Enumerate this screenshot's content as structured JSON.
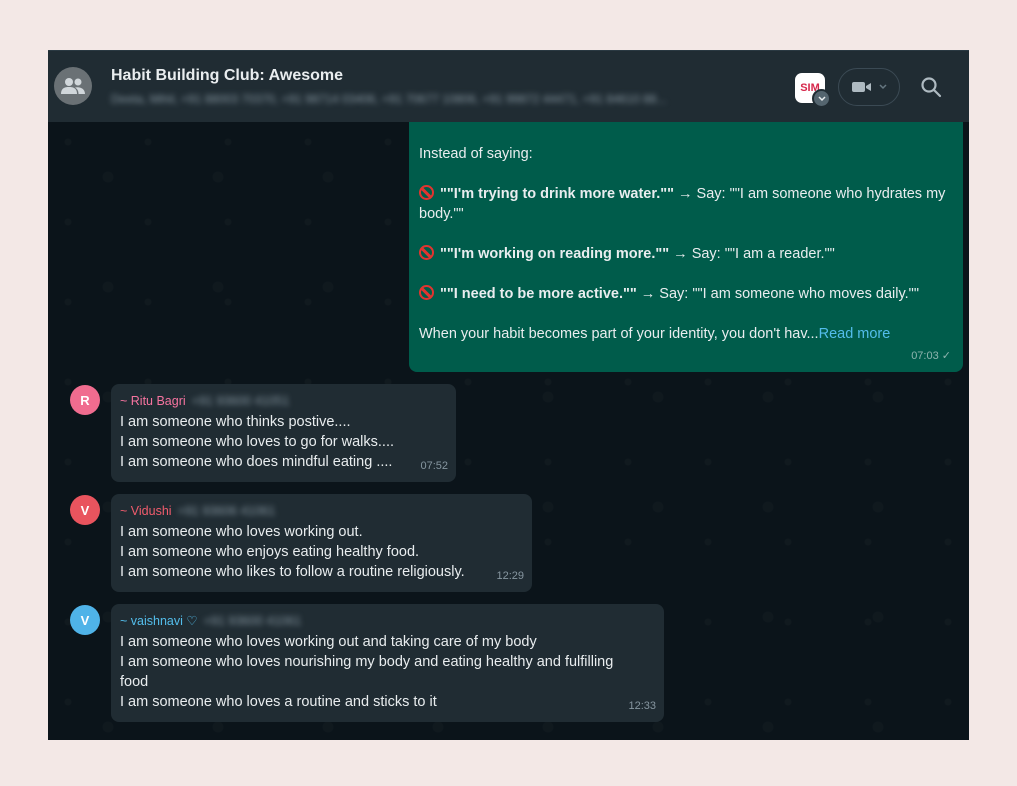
{
  "header": {
    "title": "Habit Building Club: Awesome",
    "participants": "Deeta, Mihil, +91 88003 70370, +91 98714 03406, +91 70677 10806, +91 99872 44471, +91 84610 88...",
    "sim_badge": "SIM"
  },
  "outgoing": {
    "intro": "Instead of saying:",
    "lines": [
      {
        "bold": "\"\"I'm trying to drink more water.\"\"",
        "rest": " → Say: \"\"I am someone who hydrates my body.\"\""
      },
      {
        "bold": "\"\"I'm working on reading more.\"\"",
        "rest": " → Say: \"\"I am a reader.\"\""
      },
      {
        "bold": "\"\"I need to be more active.\"\"",
        "rest": " → Say: \"\"I am someone who moves daily.\"\""
      }
    ],
    "closing": "When your habit becomes part of your identity, you don't hav...",
    "read_more": "Read more",
    "time": "07:03",
    "tick": "✓"
  },
  "messages": [
    {
      "initial": "R",
      "avatar_color": "#f06c8f",
      "name_color": "#f774a0",
      "sender": "~ Ritu Bagri",
      "phone": "+91 93600 41051",
      "lines": [
        "I am someone who thinks postive....",
        "I am someone who loves to go for walks....",
        "I am someone who does mindful eating ...."
      ],
      "time": "07:52"
    },
    {
      "initial": "V",
      "avatar_color": "#e9545e",
      "name_color": "#f15c6d",
      "sender": "~ Vidushi",
      "phone": "+91 93606 41061",
      "lines": [
        "I am someone who loves working out.",
        "I am someone who enjoys eating healthy food.",
        "I am someone who likes to follow a routine religiously."
      ],
      "time": "12:29"
    },
    {
      "initial": "V",
      "avatar_color": "#4fb3e8",
      "name_color": "#53bdeb",
      "sender": "~ vaishnavi ♡",
      "phone": "+91 93600 41061",
      "lines": [
        "I am someone who loves working out and taking care of my body",
        "I am someone who loves nourishing my body and eating healthy and fulfilling",
        "food",
        "I am someone who loves a routine and sticks to it"
      ],
      "time": "12:33"
    }
  ]
}
